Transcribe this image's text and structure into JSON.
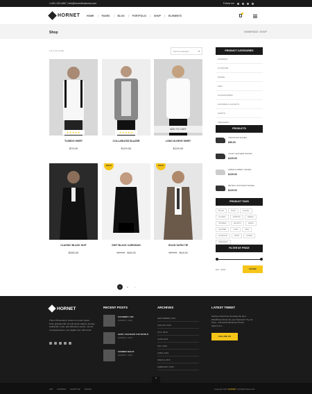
{
  "topbar": {
    "contact": "1-001-123-4567  |  info@hornetbusiness.com",
    "follow": "Follow me"
  },
  "header": {
    "brand": "HORNET",
    "nav": [
      "HOME",
      "PAGES",
      "BLOG",
      "PORTFOLIO",
      "SHOP",
      "ELEMENTS"
    ]
  },
  "titlebar": {
    "title": "Shop",
    "breadcrumb": "HOMEPAGE / SHOP"
  },
  "shop": {
    "count": "1-6 of 12 results",
    "sort": "Sort by newness"
  },
  "products": [
    {
      "name": "TUXEDO SHIRT",
      "price": "$79.00",
      "old": "",
      "sale": false,
      "stars": "★★★★★",
      "addcart": ""
    },
    {
      "name": "COLLARLESS BLAZER",
      "price": "$129.00",
      "old": "",
      "sale": false,
      "stars": "★★★★★",
      "addcart": ""
    },
    {
      "name": "LONG SLEEVE SHIRT",
      "price": "$129.00",
      "old": "",
      "sale": false,
      "stars": "",
      "addcart": "ADD TO CART"
    },
    {
      "name": "CLASSIC BLACK SUIT",
      "price": "$289.00",
      "old": "",
      "sale": false,
      "stars": "",
      "addcart": ""
    },
    {
      "name": "KNIT BLACK CARDIGAN",
      "price": "$49.00",
      "old": "$89.00",
      "sale": true,
      "stars": "",
      "addcart": ""
    },
    {
      "name": "SOLID SATIN TIE",
      "price": "$19.00",
      "old": "$29.00",
      "sale": true,
      "stars": "",
      "addcart": ""
    }
  ],
  "sale_label": "SALE",
  "sidebar": {
    "categories_head": "PRODUCT CATEGORIES",
    "categories": [
      "HOMEDAY",
      "OUTDOOR",
      "MODEL",
      "MAN",
      "ACCESSORIES",
      "HOODIES & JACKETS",
      "SHIRTS",
      "SNEAKERS"
    ],
    "products_head": "PRODUCTS",
    "products": [
      {
        "name": "TRICOLOR SHOES",
        "price": "$99.00"
      },
      {
        "name": "LIGHT LEATHER SHOES",
        "price": "$129.00"
      },
      {
        "name": "URBAN FABRIC SHOES",
        "price": "$129.00"
      },
      {
        "name": "RETRO OUTDOOR SHOES",
        "price": "$129.00"
      }
    ],
    "tags_head": "PRODUCT TAGS",
    "tags": [
      "BLACK",
      "BLUE",
      "CASUAL",
      "CLASSIC",
      "FASHION",
      "GREEN",
      "HOODIES",
      "JACKETS",
      "JEANS",
      "LEATHER",
      "LONG",
      "MAN",
      "OUTDOOR",
      "SHIRT",
      "SHOES",
      "SNEAKERS"
    ],
    "filter_head": "FILTER BY PRICE",
    "range": "$19 - $289",
    "filter_btn": "FILTER"
  },
  "pager": [
    "1",
    "2",
    "›"
  ],
  "footer": {
    "brand": "HORNET",
    "about": "This is Photoshop's version of Lorem Ipsum. Proin gravida nibh vel velit auctor aliquet. Aenean sollicitudin, lorem quis bibendum auctor, nisi elit consequat ipsum, nec sagittis sem nibh id elit.",
    "recent_head": "RECENT POSTS",
    "recent": [
      {
        "title": "GOURMET LIFE",
        "date": "JANUARY 1, 2015"
      },
      {
        "title": "HOW I CHANGED THE WORLD",
        "date": "JANUARY 1, 2015"
      },
      {
        "title": "SUMMER NIGHT",
        "date": "JANUARY 1, 2015"
      }
    ],
    "archives_head": "ARCHIVES",
    "archives": [
      "SEPTEMBER 2015",
      "AUGUST 2015",
      "JULY 2015",
      "JUNE 2015",
      "MAY 2015",
      "APRIL 2015",
      "MARCH 2015",
      "FEBRUARY 2015"
    ],
    "tweet_head": "LATEST TWEET",
    "tweet": "Having a hard time choosing the best WordPress theme for your business? Try out Onyx - A Powerful Business Theme. https://t.co/...",
    "tweet_btn": "FOLLOW US"
  },
  "bottom": {
    "links": [
      "ART",
      "FASHION",
      "LIFESTYLE",
      "TRAVEL"
    ],
    "copy_pre": "Copyright 2015 ",
    "copy_brand": "HORNET",
    "copy_post": " | All Rights Reserved",
    "totop": "⌃"
  }
}
